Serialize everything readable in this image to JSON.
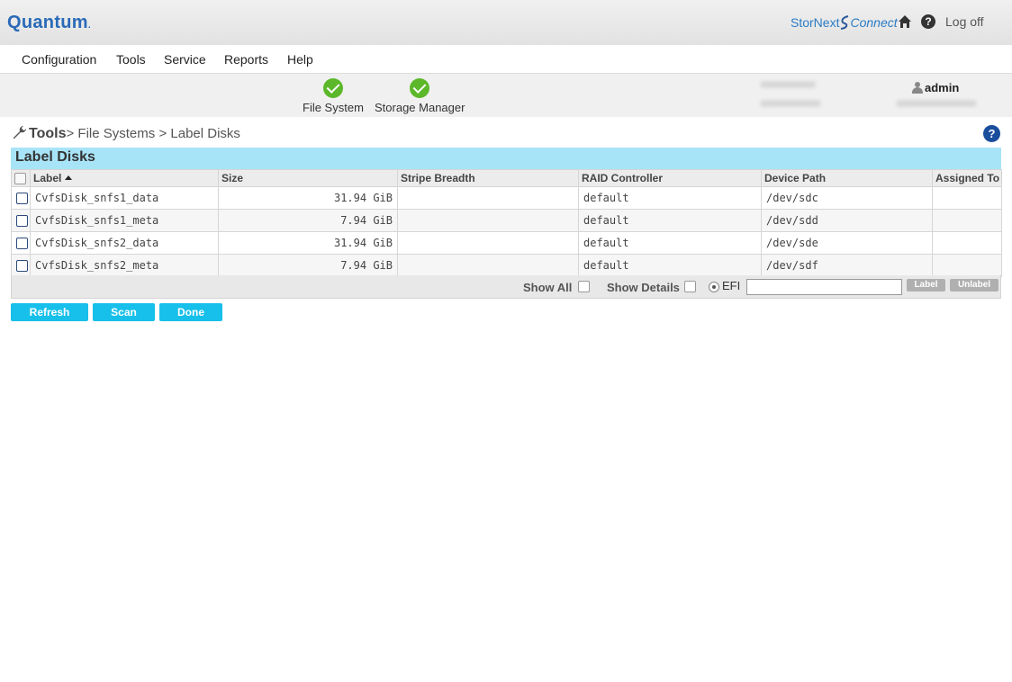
{
  "header": {
    "logo": "Quantum",
    "logo_mark": ".",
    "stornext": "StorNext",
    "connect": "Connect",
    "logoff": "Log off"
  },
  "menu": [
    "Configuration",
    "Tools",
    "Service",
    "Reports",
    "Help"
  ],
  "status": {
    "items": [
      {
        "label": "File System",
        "state": "ok"
      },
      {
        "label": "Storage Manager",
        "state": "ok"
      }
    ],
    "user": "admin",
    "accent_ok": "#5cb82a"
  },
  "breadcrumb": {
    "root": "Tools",
    "sep1": "> ",
    "level1": "File Systems",
    "sep2": " > ",
    "level2": "Label Disks"
  },
  "panel": {
    "title": "Label Disks",
    "columns": [
      "Label",
      "Size",
      "Stripe Breadth",
      "RAID Controller",
      "Device Path",
      "Assigned To"
    ],
    "rows": [
      {
        "label": "CvfsDisk_snfs1_data",
        "size": "31.94 GiB",
        "stripe": "",
        "raid": "default",
        "path": "/dev/sdc",
        "assigned": ""
      },
      {
        "label": "CvfsDisk_snfs1_meta",
        "size": "7.94 GiB",
        "stripe": "",
        "raid": "default",
        "path": "/dev/sdd",
        "assigned": ""
      },
      {
        "label": "CvfsDisk_snfs2_data",
        "size": "31.94 GiB",
        "stripe": "",
        "raid": "default",
        "path": "/dev/sde",
        "assigned": ""
      },
      {
        "label": "CvfsDisk_snfs2_meta",
        "size": "7.94 GiB",
        "stripe": "",
        "raid": "default",
        "path": "/dev/sdf",
        "assigned": ""
      }
    ],
    "show_all": "Show All",
    "show_details": "Show Details",
    "efi": "EFI",
    "label_btn": "Label",
    "unlabel_btn": "Unlabel"
  },
  "buttons": {
    "refresh": "Refresh",
    "scan": "Scan",
    "done": "Done"
  },
  "colors": {
    "accent_button": "#17c0ea",
    "panel_title": "#a8e4f7",
    "brand": "#2a6ab8"
  }
}
